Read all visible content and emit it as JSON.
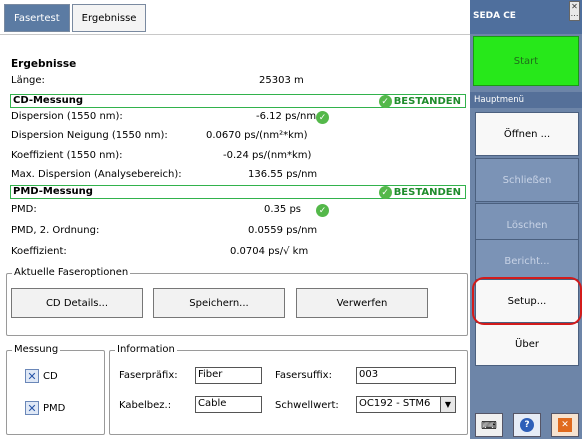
{
  "tabs": [
    {
      "label": "Fasertest",
      "active": true
    },
    {
      "label": "Ergebnisse",
      "active": false
    }
  ],
  "results": {
    "title": "Ergebnisse",
    "length_label": "Länge:",
    "length_value": "25303 m",
    "cd": {
      "title": "CD-Messung",
      "status": "BESTANDEN",
      "rows": [
        {
          "label": "Dispersion (1550 nm):",
          "value": "-6.12 ps/nm"
        },
        {
          "label": "Dispersion Neigung (1550 nm):",
          "value": "0.0670 ps/(nm²*km)"
        },
        {
          "label": "Koeffizient (1550 nm):",
          "value": "-0.24 ps/(nm*km)"
        },
        {
          "label": "Max. Dispersion (Analysebereich):",
          "value": "136.55 ps/nm"
        }
      ]
    },
    "pmd": {
      "title": "PMD-Messung",
      "status": "BESTANDEN",
      "rows": [
        {
          "label": "PMD:",
          "value": "0.35 ps"
        },
        {
          "label": "PMD, 2. Ordnung:",
          "value": "0.0559 ps/nm"
        },
        {
          "label": "Koeffizient:",
          "value": "0.0704 ps/√ km"
        }
      ]
    }
  },
  "options": {
    "title": "Aktuelle Faseroptionen",
    "cd_details": "CD Details...",
    "save": "Speichern...",
    "discard": "Verwerfen"
  },
  "measurement": {
    "title": "Messung",
    "cd": "CD",
    "pmd": "PMD"
  },
  "information": {
    "title": "Information",
    "prefix_label": "Faserpräfix:",
    "prefix_value": "Fiber",
    "suffix_label": "Fasersuffix:",
    "suffix_value": "003",
    "cable_label": "Kabelbez.:",
    "cable_value": "Cable",
    "threshold_label": "Schwellwert:",
    "threshold_value": "OC192 - STM6"
  },
  "right_panel": {
    "title": "SEDA CE",
    "start": "Start",
    "main_menu": "Hauptmenü",
    "open": "Öffnen ...",
    "close": "Schließen",
    "delete": "Löschen",
    "report": "Bericht...",
    "setup": "Setup...",
    "about": "Über"
  },
  "colors": {
    "tab_active": "#5b7ba3",
    "pass_green": "#32b24c",
    "start_green": "#27e81a",
    "panel_blue": "#6d85a8",
    "highlight_red": "#d31b1b"
  },
  "icons": [
    "check-icon",
    "checkbox-x-icon",
    "dropdown-arrow-icon",
    "keyboard-icon",
    "help-icon",
    "exit-icon",
    "close-icon"
  ]
}
